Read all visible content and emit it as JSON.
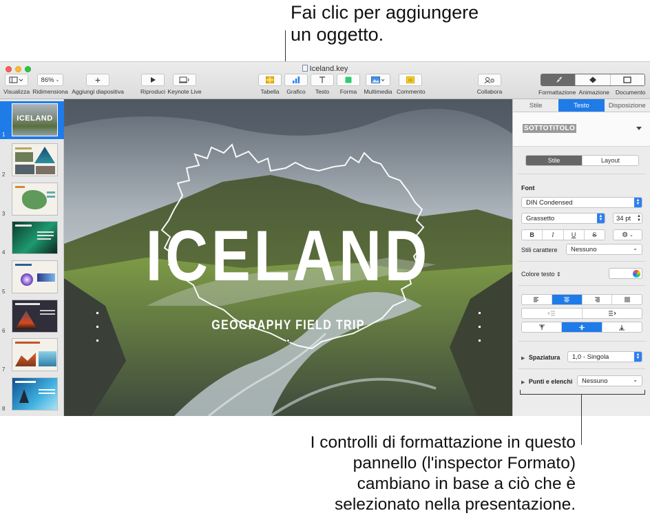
{
  "callouts": {
    "top": [
      "Fai clic per aggiungere",
      "un oggetto."
    ],
    "bottom": [
      "I controlli di formattazione in questo",
      "pannello (l'inspector Formato)",
      "cambiano in base a ciò che è",
      "selezionato nella presentazione."
    ]
  },
  "window": {
    "title": "Iceland.key",
    "toolbar": {
      "view_label": "Visualizza",
      "zoom_value": "86%",
      "zoom_label": "Ridimensiona",
      "add_slide_label": "Aggiungi diapositiva",
      "play_label": "Riproduci",
      "keynote_live_label": "Keynote Live",
      "table_label": "Tabella",
      "chart_label": "Grafico",
      "text_label": "Testo",
      "shape_label": "Forma",
      "media_label": "Multimedia",
      "comment_label": "Commento",
      "collaborate_label": "Collabora",
      "format_label": "Formattazione",
      "animate_label": "Animazione",
      "document_label": "Documento"
    }
  },
  "navigator": {
    "slides": [
      {
        "number": "1",
        "selected": true,
        "caption": "ICELAND"
      },
      {
        "number": "2",
        "caption": ""
      },
      {
        "number": "3",
        "caption": ""
      },
      {
        "number": "4",
        "caption": ""
      },
      {
        "number": "5",
        "caption": ""
      },
      {
        "number": "6",
        "caption": ""
      },
      {
        "number": "7",
        "caption": ""
      },
      {
        "number": "8",
        "caption": ""
      }
    ]
  },
  "slide": {
    "title": "ICELAND",
    "subtitle": "GEOGRAPHY FIELD TRIP"
  },
  "inspector": {
    "tabs": [
      "Stile",
      "Testo",
      "Disposizione"
    ],
    "active_tab": "Testo",
    "paragraph_style": "SOTTOTITOLO",
    "subtabs": [
      "Stile",
      "Layout"
    ],
    "font_section": "Font",
    "font_name": "DIN Condensed",
    "font_weight": "Grassetto",
    "font_size": "34 pt",
    "bold": "B",
    "italic": "I",
    "underline": "U",
    "strike": "S",
    "char_styles_label": "Stili carattere",
    "char_styles_value": "Nessuno",
    "text_color_label": "Colore testo",
    "spacing_label": "Spaziatura",
    "spacing_value": "1,0 - Singola",
    "bullets_label": "Punti e elenchi",
    "bullets_value": "Nessuno"
  },
  "colors": {
    "accent": "#1f7be8"
  }
}
